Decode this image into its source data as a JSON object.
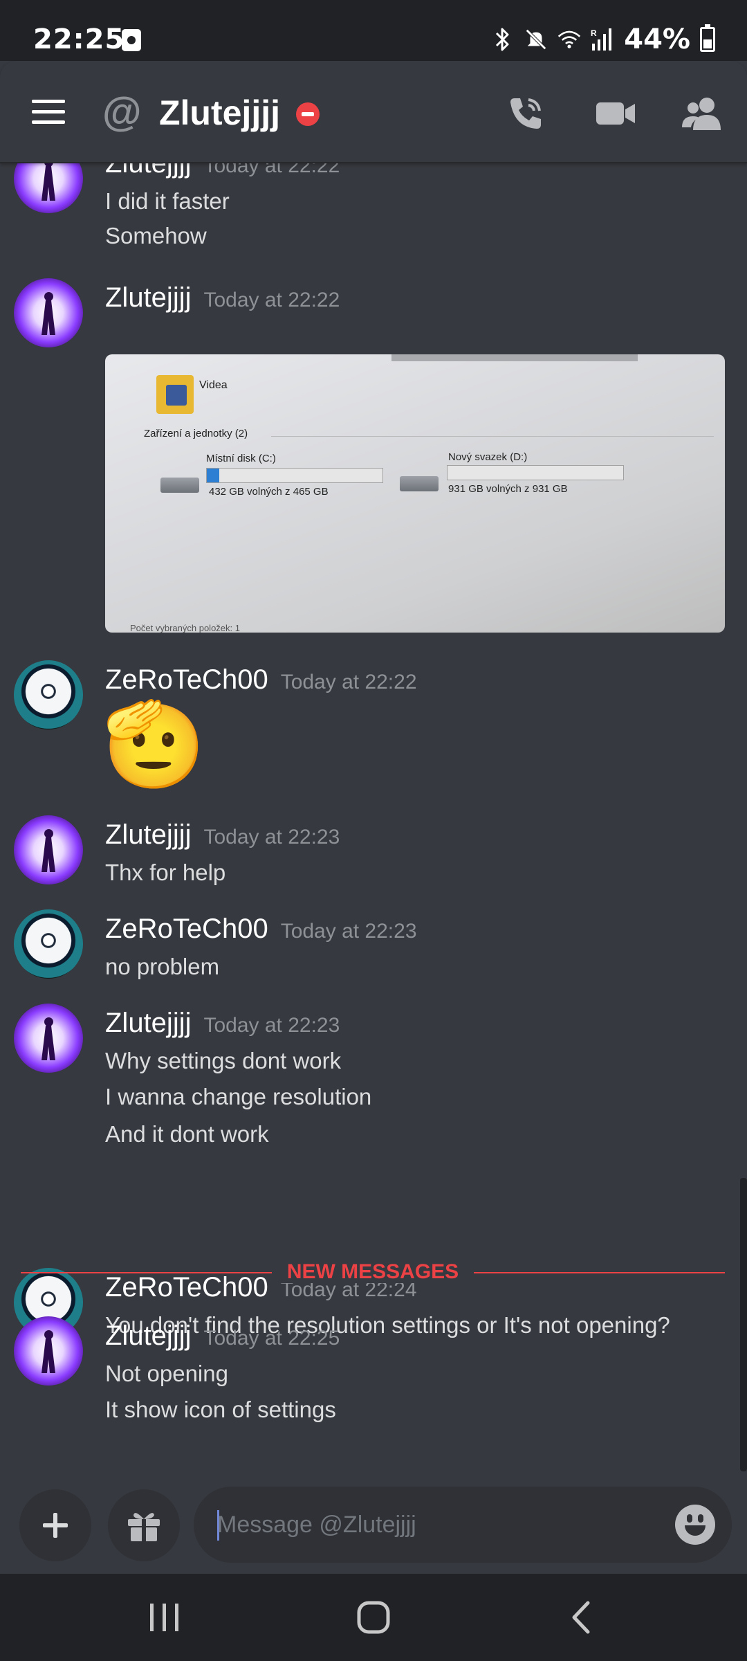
{
  "status_bar": {
    "time": "22:25",
    "battery": "44%",
    "battery_level": 0.44,
    "icons": [
      "screen-record-icon",
      "bluetooth-icon",
      "mute-icon",
      "wifi-icon",
      "signal-icon",
      "battery-icon"
    ]
  },
  "header": {
    "title": "Zlutejjjj",
    "status": "do-not-disturb",
    "icons": [
      "hamburger-icon",
      "at-icon",
      "dnd-icon",
      "call-icon",
      "video-icon",
      "members-icon"
    ]
  },
  "messages": [
    {
      "author": "Zlutejjjj",
      "time": "Today at 22:22",
      "lines": [
        "I did it faster",
        "Somehow"
      ]
    },
    {
      "author": "Zlutejjjj",
      "time": "Today at 22:22",
      "attachment": {
        "folder_label": "Videa",
        "section_label": "Zařízení a jednotky (2)",
        "drive_c_label": "Místní disk (C:)",
        "drive_c_free": "432 GB volných z 465 GB",
        "drive_c_used_fraction": 0.07,
        "drive_d_label": "Nový svazek (D:)",
        "drive_d_free": "931 GB volných z 931 GB",
        "drive_d_used_fraction": 0.0,
        "footer_label": "Počet vybraných položek: 1"
      }
    },
    {
      "author": "ZeRoTeCh00",
      "time": "Today at 22:22",
      "emoji": "🫡"
    },
    {
      "author": "Zlutejjjj",
      "time": "Today at 22:23",
      "lines": [
        "Thx for help"
      ]
    },
    {
      "author": "ZeRoTeCh00",
      "time": "Today at 22:23",
      "lines": [
        "no problem"
      ]
    },
    {
      "author": "Zlutejjjj",
      "time": "Today at 22:23",
      "lines": [
        "Why settings dont work",
        "I wanna change resolution",
        "And it dont work"
      ]
    },
    {
      "author": "ZeRoTeCh00",
      "time": "Today at 22:24",
      "lines": [
        "You don't find the resolution settings or It's not opening?"
      ]
    },
    {
      "author": "Zlutejjjj",
      "time": "Today at 22:25",
      "lines": [
        "Not opening",
        "It show icon of settings"
      ]
    }
  ],
  "divider_label": "NEW MESSAGES",
  "composer": {
    "placeholder": "Message @Zlutejjjj",
    "value": ""
  },
  "colors": {
    "background": "#36393f",
    "status_bar": "#202225",
    "accent_red": "#ed4245",
    "text": "#dcddde",
    "muted": "#8e9297"
  }
}
